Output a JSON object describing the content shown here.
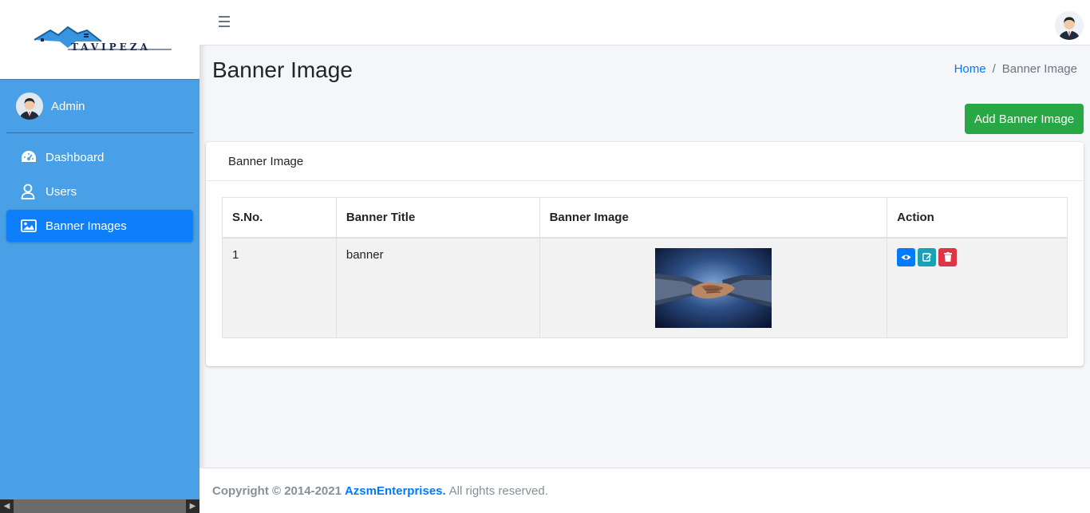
{
  "brand": {
    "name": "TAVIPEZA"
  },
  "sidebar": {
    "user": "Admin",
    "items": [
      {
        "label": "Dashboard",
        "icon": "dashboard-icon"
      },
      {
        "label": "Users",
        "icon": "user-icon"
      },
      {
        "label": "Banner Images",
        "icon": "image-icon",
        "active": true
      }
    ]
  },
  "header": {
    "menu_icon": "hamburger-icon"
  },
  "page": {
    "title": "Banner Image",
    "breadcrumb": {
      "home": "Home",
      "separator": "/",
      "current": "Banner Image"
    },
    "add_button": "Add Banner Image"
  },
  "card": {
    "title": "Banner Image",
    "table": {
      "columns": [
        "S.No.",
        "Banner Title",
        "Banner Image",
        "Action"
      ],
      "rows": [
        {
          "sno": "1",
          "title": "banner",
          "image": "handshake-image",
          "actions": [
            "view-icon",
            "edit-icon",
            "delete-icon"
          ]
        }
      ]
    }
  },
  "footer": {
    "copyright": "Copyright © 2014-2021",
    "company": "AzsmEnterprises.",
    "rights": "All rights reserved."
  },
  "colors": {
    "sidebar_bg": "#4aa0e6",
    "active_item": "#0d7ffa",
    "add_button": "#28a745",
    "view_button": "#007bff",
    "edit_button": "#17a2b8",
    "delete_button": "#dc3545"
  }
}
